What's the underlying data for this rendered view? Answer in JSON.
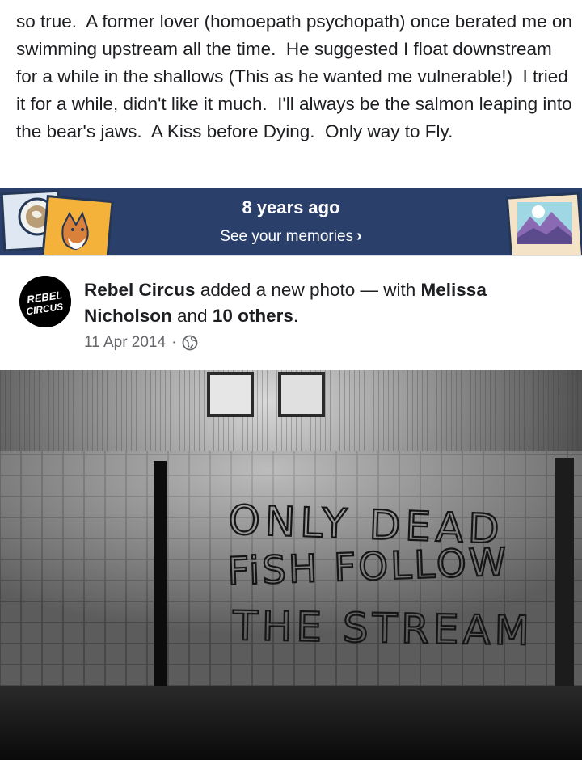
{
  "comment": {
    "text": "so true.  A former lover (homoepath psychopath) once berated me on swimming upstream all the time.  He suggested I float downstream for a while in the shallows (This as he wanted me vulnerable!)  I tried it for a while, didn't like it much.  I'll always be the salmon leaping into the bear's jaws.  A Kiss before Dying.  Only way to Fly."
  },
  "memories": {
    "title": "8 years ago",
    "link_label": "See your memories",
    "chevron_icon": "chevron-right-icon",
    "bg_color": "#2b3f6b"
  },
  "post": {
    "avatar_text": "REBEL CIRCUS",
    "author": "Rebel Circus",
    "action": "added a new photo — with",
    "tagged": "Melissa Nicholson",
    "and": "and",
    "others": "10 others",
    "period": ".",
    "date": "11 Apr 2014",
    "separator": "·",
    "privacy_icon": "globe-icon"
  },
  "photo": {
    "graffiti": [
      "ONLY DEAD",
      "FiSH FOLLOW",
      "THE STREAM"
    ]
  }
}
